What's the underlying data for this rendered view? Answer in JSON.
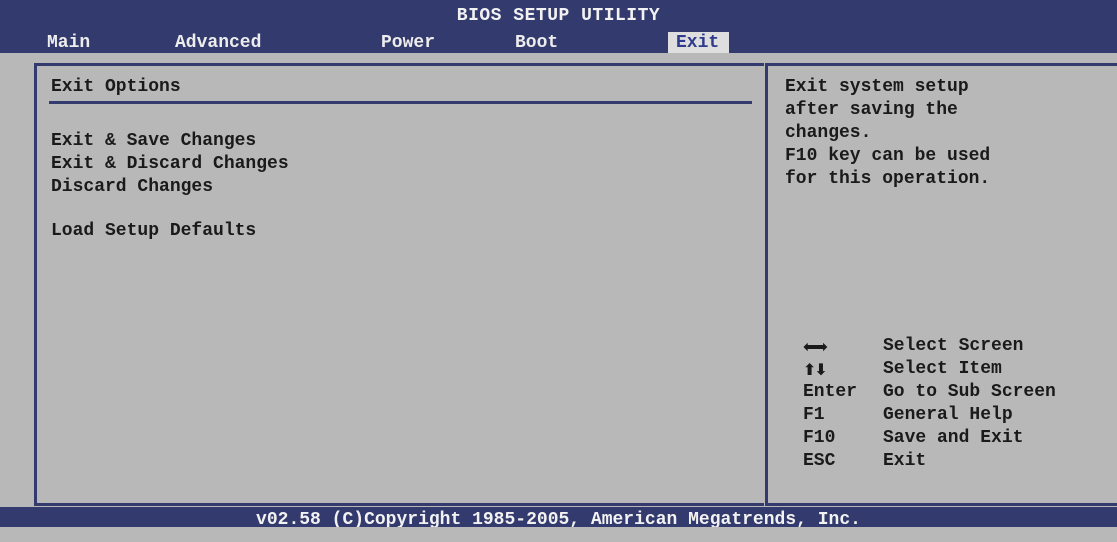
{
  "header": {
    "title": "BIOS SETUP UTILITY",
    "tabs": [
      {
        "label": "Main",
        "active": false
      },
      {
        "label": "Advanced",
        "active": false
      },
      {
        "label": "Power",
        "active": false
      },
      {
        "label": "Boot",
        "active": false
      },
      {
        "label": "Exit",
        "active": true
      }
    ]
  },
  "main": {
    "section_title": "Exit Options",
    "items": [
      {
        "label": "Exit & Save Changes"
      },
      {
        "label": "Exit & Discard Changes"
      },
      {
        "label": "Discard Changes"
      },
      {
        "label": "Load Setup Defaults"
      }
    ]
  },
  "help": {
    "text": "Exit system setup\nafter saving the\nchanges.\nF10 key can be used\nfor this operation.",
    "keys": [
      {
        "key_icon": "left-right-arrows-icon",
        "key": "",
        "desc": "Select Screen"
      },
      {
        "key_icon": "up-down-arrows-icon",
        "key": "",
        "desc": "Select Item"
      },
      {
        "key": "Enter",
        "desc": "Go to Sub Screen"
      },
      {
        "key": "F1",
        "desc": "General Help"
      },
      {
        "key": "F10",
        "desc": "Save and Exit"
      },
      {
        "key": "ESC",
        "desc": "Exit"
      }
    ]
  },
  "footer": {
    "copyright": "v02.58 (C)Copyright 1985-2005, American Megatrends, Inc."
  },
  "colors": {
    "header_bg": "#333a6e",
    "body_bg": "#b8b8b8",
    "active_tab_bg": "#dedede",
    "active_tab_fg": "#2e3a8c"
  }
}
